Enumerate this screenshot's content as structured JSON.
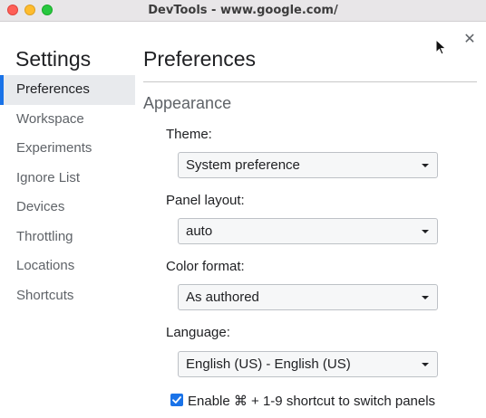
{
  "window": {
    "title": "DevTools - www.google.com/"
  },
  "sidebar": {
    "heading": "Settings",
    "items": [
      {
        "label": "Preferences"
      },
      {
        "label": "Workspace"
      },
      {
        "label": "Experiments"
      },
      {
        "label": "Ignore List"
      },
      {
        "label": "Devices"
      },
      {
        "label": "Throttling"
      },
      {
        "label": "Locations"
      },
      {
        "label": "Shortcuts"
      }
    ],
    "active_index": 0
  },
  "main": {
    "heading": "Preferences",
    "section": "Appearance",
    "fields": [
      {
        "label": "Theme:",
        "value": "System preference"
      },
      {
        "label": "Panel layout:",
        "value": "auto"
      },
      {
        "label": "Color format:",
        "value": "As authored"
      },
      {
        "label": "Language:",
        "value": "English (US) - English (US)"
      }
    ],
    "checkbox": {
      "label": "Enable ⌘ + 1-9 shortcut to switch panels",
      "checked": true
    }
  },
  "icons": {
    "close": "close-icon",
    "dropdown": "chevron-down-icon",
    "cursor": "mouse-pointer-icon",
    "check": "checkmark-icon"
  },
  "colors": {
    "accent": "#1a73e8",
    "active_item_bg": "#e8eaed",
    "window_close": "#fe5f57",
    "window_minimize": "#febc2e",
    "window_maximize": "#28c840"
  }
}
